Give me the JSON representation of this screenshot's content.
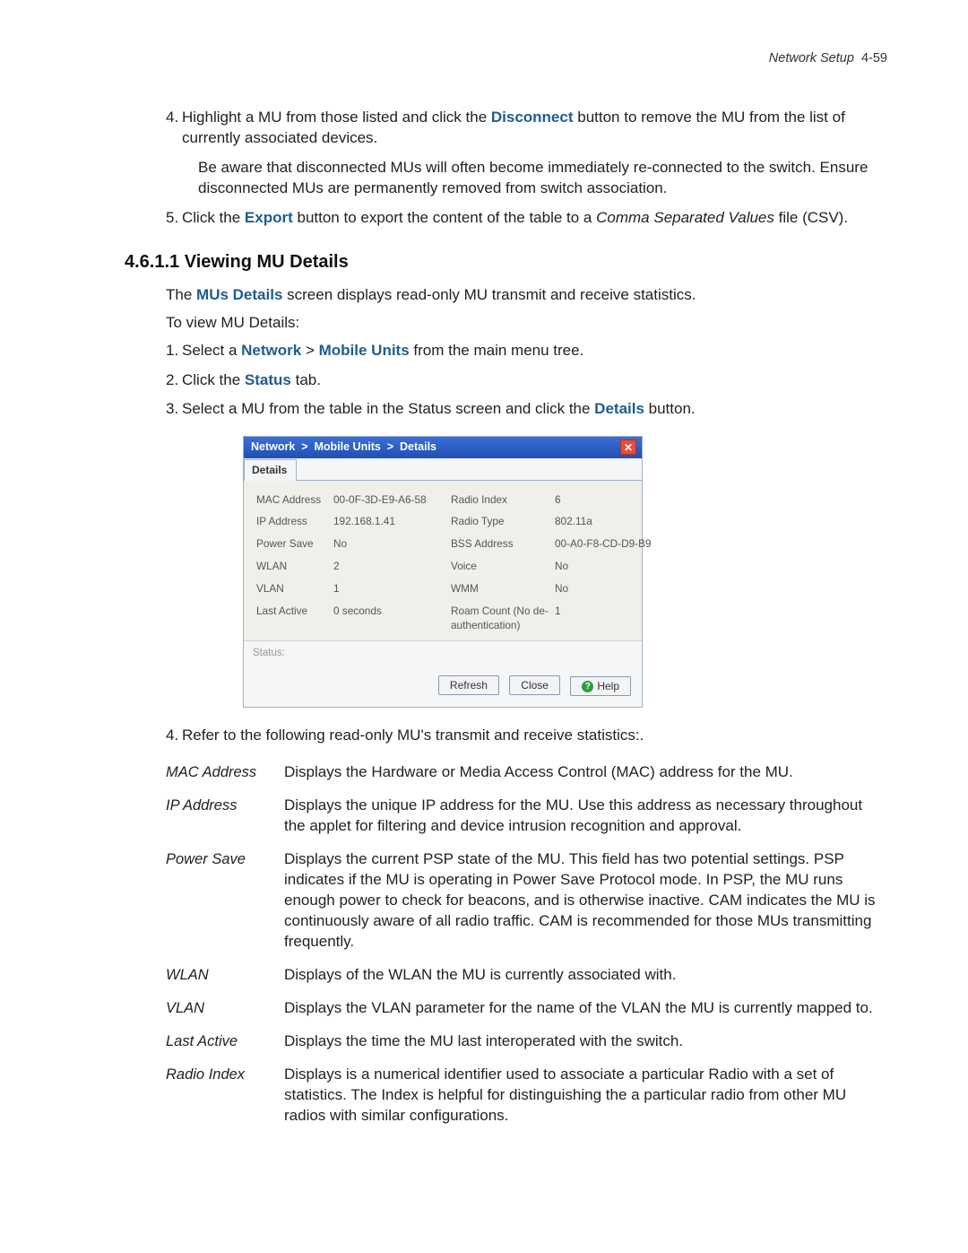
{
  "header": {
    "left": "Network Setup",
    "right": "4-59"
  },
  "step4": {
    "num": "4.",
    "pre": "Highlight a MU from those listed and click the ",
    "bold": "Disconnect",
    "post": " button to remove the MU from the list of currently associated devices.",
    "note": "Be aware that disconnected MUs will often become immediately re-connected to the switch. Ensure disconnected MUs are permanently removed from switch association."
  },
  "step5": {
    "num": "5.",
    "pre": "Click the ",
    "bold": "Export",
    "mid": " button to export the content of the table to a ",
    "ital": "Comma Separated Values",
    "post": " file (CSV)."
  },
  "section_title": "4.6.1.1 Viewing MU Details",
  "intro": {
    "pre": "The ",
    "bold": "MUs Details",
    "post": " screen displays read-only MU transmit and receive statistics."
  },
  "intro2": "To view MU Details:",
  "s1": {
    "num": "1.",
    "pre": "Select a ",
    "b1": "Network",
    "sep": " > ",
    "b2": "Mobile Units",
    "post": " from the main menu tree."
  },
  "s2": {
    "num": "2.",
    "pre": "Click the ",
    "bold": "Status",
    "post": " tab."
  },
  "s3": {
    "num": "3.",
    "pre": "Select a MU from the table in the Status screen and click the ",
    "bold": "Details",
    "post": " button."
  },
  "window": {
    "breadcrumb": "Network  >  Mobile Units  >  Details",
    "tab": "Details",
    "rows": [
      {
        "l1": "MAC Address",
        "v1": "00-0F-3D-E9-A6-58",
        "l2": "Radio Index",
        "v2": "6"
      },
      {
        "l1": "IP Address",
        "v1": "192.168.1.41",
        "l2": "Radio Type",
        "v2": "802.11a"
      },
      {
        "l1": "Power Save",
        "v1": "No",
        "l2": "BSS Address",
        "v2": "00-A0-F8-CD-D9-B9"
      },
      {
        "l1": "WLAN",
        "v1": "2",
        "l2": "Voice",
        "v2": "No"
      },
      {
        "l1": "VLAN",
        "v1": "1",
        "l2": "WMM",
        "v2": "No"
      },
      {
        "l1": "Last Active",
        "v1": "0 seconds",
        "l2": "Roam Count (No de-authentication)",
        "v2": "1"
      }
    ],
    "status_label": "Status:",
    "buttons": {
      "refresh": "Refresh",
      "close": "Close",
      "help": "Help"
    }
  },
  "step_post": {
    "num": "4.",
    "text": "Refer to the following read-only MU's transmit and receive statistics:."
  },
  "defs": [
    {
      "term": "MAC Address",
      "desc": "Displays the Hardware or Media Access Control (MAC) address for the MU."
    },
    {
      "term": "IP Address",
      "desc": "Displays the unique IP address for the MU. Use this address as necessary throughout the applet for filtering and device intrusion recognition and approval."
    },
    {
      "term": "Power Save",
      "desc": "Displays the current PSP state of the MU. This field has two potential settings. PSP indicates if the MU is operating in Power Save Protocol mode. In PSP, the MU runs enough power to check for beacons, and is otherwise inactive. CAM indicates the MU is continuously aware of all radio traffic. CAM is recommended for those MUs transmitting frequently."
    },
    {
      "term": "WLAN",
      "desc": "Displays of the WLAN the MU is currently associated with."
    },
    {
      "term": "VLAN",
      "desc": "Displays the VLAN parameter for the name of the VLAN the MU is currently mapped to."
    },
    {
      "term": "Last Active",
      "desc": "Displays the time the MU last interoperated with the switch."
    },
    {
      "term": "Radio Index",
      "desc": "Displays is a numerical identifier used to associate a particular Radio with a set of statistics. The Index is helpful for distinguishing the a particular radio from other MU radios with similar configurations."
    }
  ]
}
